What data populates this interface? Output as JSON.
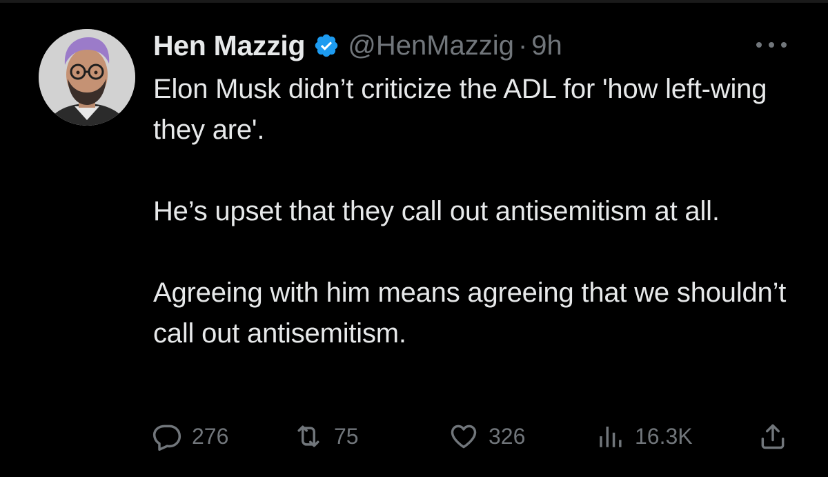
{
  "tweet": {
    "author": {
      "display_name": "Hen Mazzig",
      "handle": "@HenMazzig",
      "verified": true
    },
    "separator": "·",
    "time": "9h",
    "paragraphs": [
      "Elon Musk didn’t criticize the ADL for 'how left-wing they are'.",
      "He’s upset that they call out antisemitism at all.",
      "Agreeing with him means agreeing that we shouldn’t call out antisemitism."
    ],
    "metrics": {
      "replies": "276",
      "retweets": "75",
      "likes": "326",
      "views": "16.3K"
    }
  },
  "icons": {
    "reply": "speech-bubble-icon",
    "retweet": "retweet-arrows-icon",
    "like": "heart-outline-icon",
    "views": "bar-chart-icon",
    "share": "upload-arrow-icon",
    "more": "more-dots-icon",
    "verified": "verified-badge-icon"
  },
  "colors": {
    "background": "#000000",
    "text_primary": "#e7e9ea",
    "text_secondary": "#71767b",
    "verified_blue": "#1d9bf0"
  }
}
